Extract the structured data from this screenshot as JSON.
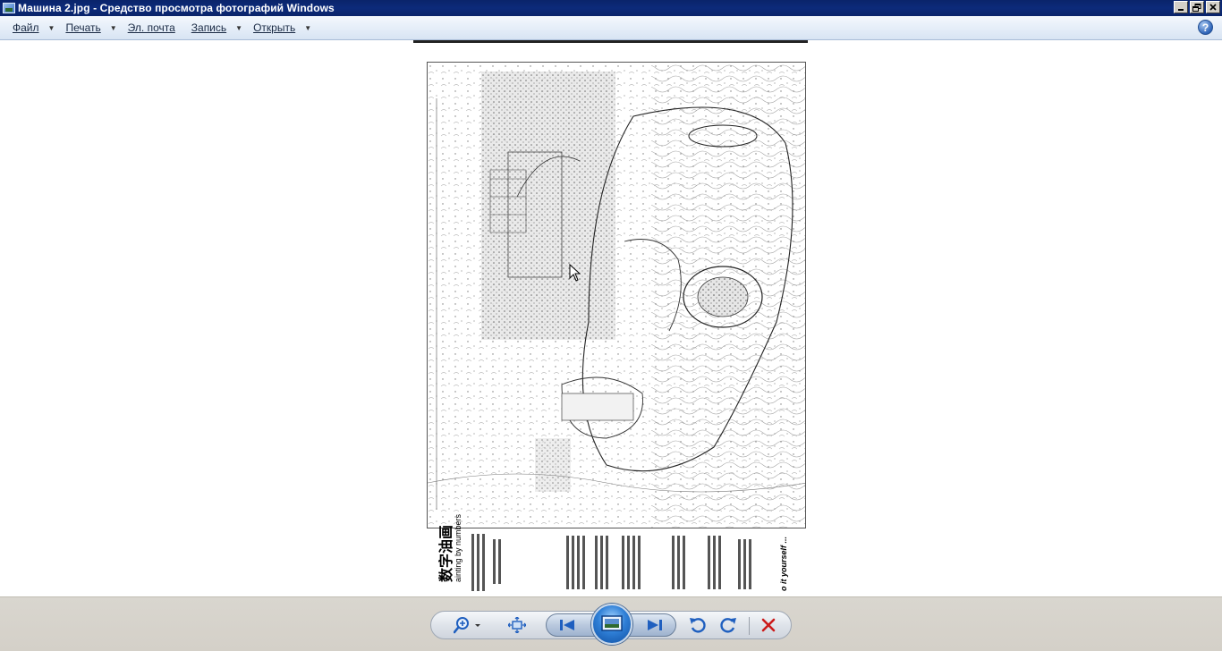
{
  "window": {
    "title": "Машина 2.jpg - Средство просмотра фотографий Windows"
  },
  "menu": {
    "file": "Файл",
    "print": "Печать",
    "email": "Эл. почта",
    "burn": "Запись",
    "open": "Открыть"
  },
  "photo": {
    "strip_title": "数字油画",
    "strip_subtitle": "ainting by numbers",
    "strip_tagline": "o it yourself ..."
  },
  "icons": {
    "help": "help-icon",
    "zoom": "zoom-icon",
    "fit": "actual-size-icon",
    "prev": "previous-icon",
    "slideshow": "slideshow-icon",
    "next": "next-icon",
    "rotate_ccw": "rotate-counterclockwise-icon",
    "rotate_cw": "rotate-clockwise-icon",
    "delete": "delete-icon"
  },
  "colors": {
    "titlebar": "#0a246a",
    "toolbar_bg": "#d4d0c8",
    "nav_blue": "#1f5fbf",
    "delete_red": "#cc1a1a"
  }
}
